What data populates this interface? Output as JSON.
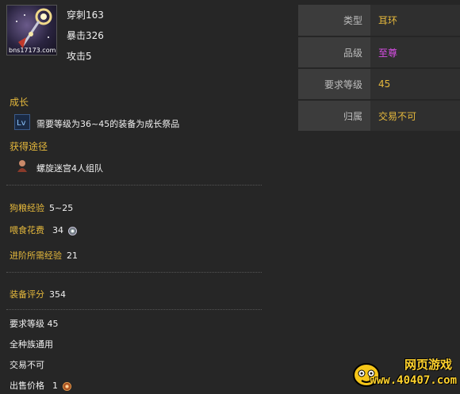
{
  "item": {
    "icon_name": "item-ring-icon",
    "watermark": "bns17173.com",
    "stats": [
      "穿刺163",
      "暴击326",
      "攻击5"
    ]
  },
  "info_table": [
    {
      "key": "类型",
      "value": "耳环",
      "color": "#e6b93c"
    },
    {
      "key": "品级",
      "value": "至尊",
      "color": "#d84ee6"
    },
    {
      "key": "要求等级",
      "value": "45",
      "color": "#e6b93c"
    },
    {
      "key": "归属",
      "value": "交易不可",
      "color": "#e6b93c"
    }
  ],
  "growth": {
    "title": "成长",
    "icon_name": "growth-icon",
    "text": "需要等级为36~45的装备为成长祭品"
  },
  "source": {
    "title": "获得途径",
    "icon_name": "dungeon-icon",
    "text": "螺旋迷宫4人组队"
  },
  "exp": {
    "exp_label": "狗粮经验",
    "exp_value": "5~25",
    "feed_label": "喂食花费",
    "feed_value": "34",
    "feed_currency_icon": "silver-coin-icon",
    "advance_label": "进阶所需经验",
    "advance_value": "21"
  },
  "score": {
    "label": "装备评分",
    "value": "354"
  },
  "requirements": {
    "level": "要求等级 45",
    "race": "全种族通用",
    "trade": "交易不可",
    "price_label": "出售价格",
    "price_value": "1",
    "price_currency_icon": "copper-coin-icon"
  },
  "watermark_logo": {
    "line1": "网页游戏",
    "line2": "www.40407.com"
  },
  "colors": {
    "gold": "#e6b93c",
    "purple": "#d84ee6",
    "background": "#262626"
  }
}
